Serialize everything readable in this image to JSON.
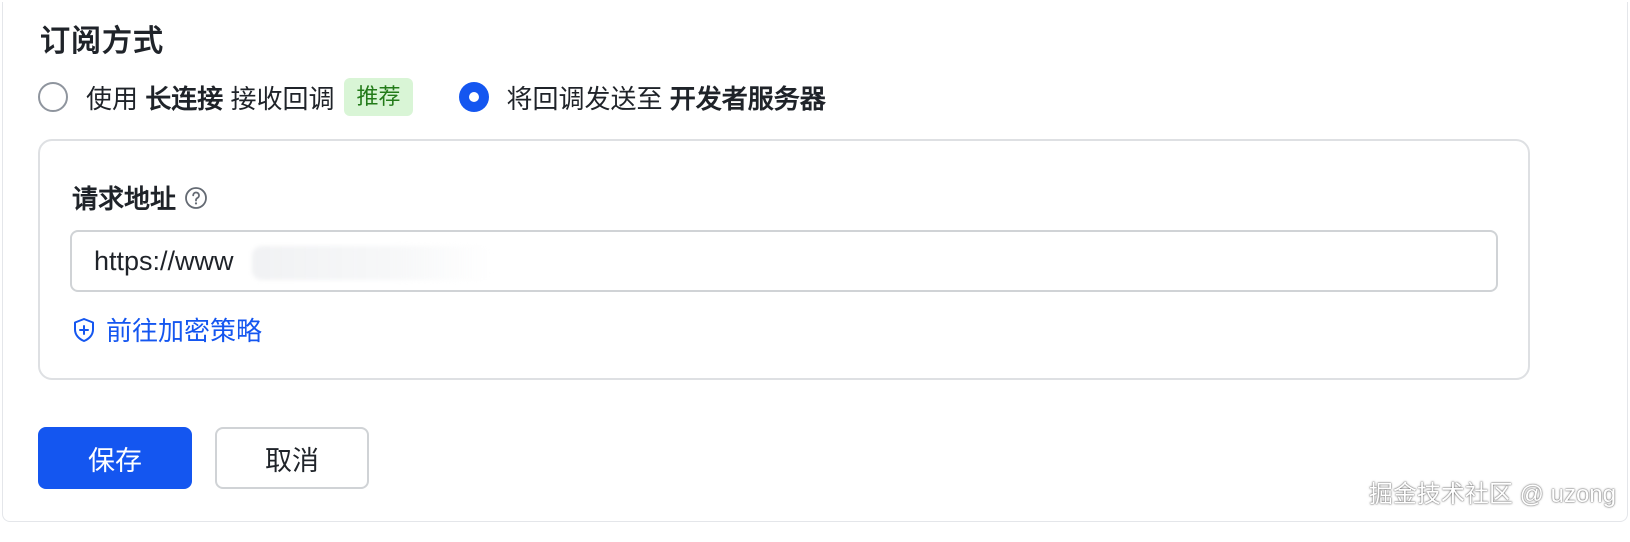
{
  "section": {
    "title": "订阅方式"
  },
  "subscription": {
    "option_long_conn": {
      "prefix": "使用 ",
      "bold": "长连接",
      "suffix": " 接收回调",
      "badge": "推荐",
      "checked": false
    },
    "option_server": {
      "prefix": "将回调发送至 ",
      "bold": "开发者服务器",
      "checked": true
    }
  },
  "request": {
    "label": "请求地址",
    "help_icon": "question-circle-icon",
    "url_value": "https://www",
    "encrypt_link": "前往加密策略",
    "encrypt_icon": "shield-plus-icon"
  },
  "actions": {
    "save": "保存",
    "cancel": "取消"
  },
  "watermark": "掘金技术社区 @ uzong",
  "colors": {
    "primary": "#1456f0",
    "badge_bg": "#d9f5d6",
    "badge_text": "#237b19",
    "text": "#1f2329",
    "border": "#dee0e3"
  }
}
